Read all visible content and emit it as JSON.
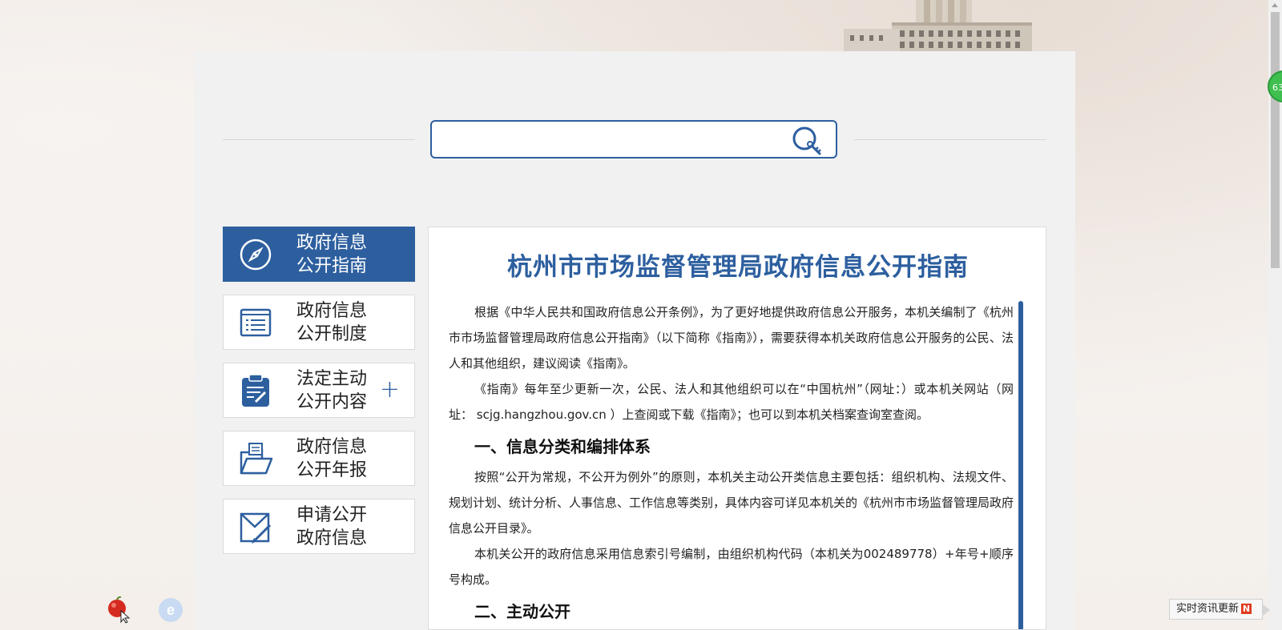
{
  "search": {
    "placeholder": ""
  },
  "nav": {
    "items": [
      {
        "line1": "政府信息",
        "line2": "公开指南",
        "icon": "compass-icon",
        "active": true
      },
      {
        "line1": "政府信息",
        "line2": "公开制度",
        "icon": "list-document-icon",
        "active": false
      },
      {
        "line1": "法定主动",
        "line2": "公开内容",
        "icon": "clipboard-edit-icon",
        "active": false,
        "expand": "+"
      },
      {
        "line1": "政府信息",
        "line2": "公开年报",
        "icon": "open-folder-icon",
        "active": false
      },
      {
        "line1": "申请公开",
        "line2": "政府信息",
        "icon": "envelope-edit-icon",
        "active": false
      }
    ]
  },
  "content": {
    "title": "杭州市市场监督管理局政府信息公开指南",
    "p1": "根据《中华人民共和国政府信息公开条例》，为了更好地提供政府信息公开服务，本机关编制了《杭州市市场监督管理局政府信息公开指南》（以下简称《指南》），需要获得本机关政府信息公开服务的公民、法人和其他组织，建议阅读《指南》。",
    "p2": "《指南》每年至少更新一次，公民、法人和其他组织可以在“中国杭州”（网址：）或本机关网站（网址： scjg.hangzhou.gov.cn ）上查阅或下载《指南》；也可以到本机关档案查询室查阅。",
    "h1": "一、信息分类和编排体系",
    "p3": "按照“公开为常规，不公开为例外”的原则，本机关主动公开类信息主要包括：组织机构、法规文件、规划计划、统计分析、人事信息、工作信息等类别，具体内容可详见本机关的《杭州市市场监督管理局政府信息公开目录》。",
    "p4": "本机关公开的政府信息采用信息索引号编制，由组织机构代码（本机关为002489778）+年号+顺序号构成。",
    "h2": "二、主动公开"
  },
  "widgets": {
    "counter": "63",
    "news_tip": "实时资讯更新",
    "news_badge": "N"
  },
  "colors": {
    "accent": "#2d5f9f",
    "background": "#f1f1f1"
  }
}
